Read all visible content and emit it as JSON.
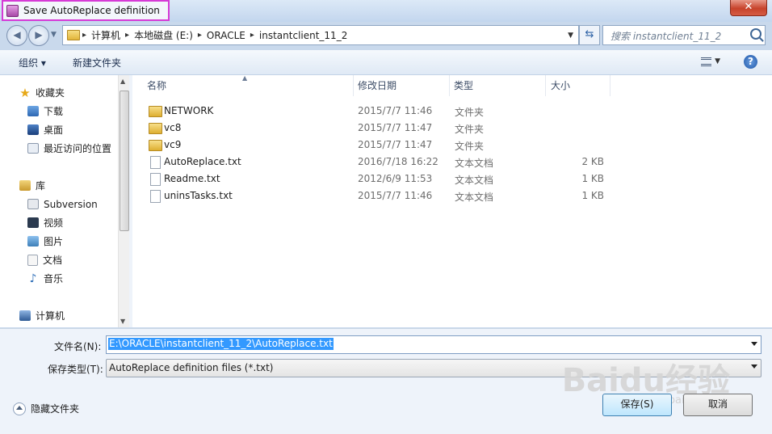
{
  "window": {
    "title": "Save AutoReplace definition",
    "close_label": "✕"
  },
  "address": {
    "crumbs": [
      "计算机",
      "本地磁盘 (E:)",
      "ORACLE",
      "instantclient_11_2"
    ],
    "search_placeholder": "搜索 instantclient_11_2"
  },
  "toolbar": {
    "organize_label": "组织 ▾",
    "new_folder_label": "新建文件夹",
    "help_label": "?"
  },
  "nav": {
    "favorites": {
      "label": "收藏夹",
      "items": [
        "下载",
        "桌面",
        "最近访问的位置"
      ]
    },
    "libraries": {
      "label": "库",
      "items": [
        "Subversion",
        "视频",
        "图片",
        "文档",
        "音乐"
      ]
    },
    "computer": {
      "label": "计算机"
    }
  },
  "columns": {
    "name": "名称",
    "date": "修改日期",
    "type": "类型",
    "size": "大小"
  },
  "files": [
    {
      "name": "NETWORK",
      "date": "2015/7/7 11:46",
      "type": "文件夹",
      "size": "",
      "kind": "folder"
    },
    {
      "name": "vc8",
      "date": "2015/7/7 11:47",
      "type": "文件夹",
      "size": "",
      "kind": "folder"
    },
    {
      "name": "vc9",
      "date": "2015/7/7 11:47",
      "type": "文件夹",
      "size": "",
      "kind": "folder"
    },
    {
      "name": "AutoReplace.txt",
      "date": "2016/7/18 16:22",
      "type": "文本文档",
      "size": "2 KB",
      "kind": "file"
    },
    {
      "name": "Readme.txt",
      "date": "2012/6/9 11:53",
      "type": "文本文档",
      "size": "1 KB",
      "kind": "file"
    },
    {
      "name": "uninsTasks.txt",
      "date": "2015/7/7 11:46",
      "type": "文本文档",
      "size": "1 KB",
      "kind": "file"
    }
  ],
  "form": {
    "filename_label": "文件名(N):",
    "filename_value": "E:\\ORACLE\\instantclient_11_2\\AutoReplace.txt",
    "filetype_label": "保存类型(T):",
    "filetype_value": "AutoReplace definition files (*.txt)"
  },
  "footer": {
    "hide_folders_label": "隐藏文件夹",
    "save_label": "保存(S)",
    "cancel_label": "取消"
  },
  "watermark": {
    "brand": "Baidu经验",
    "url": "jingyan.baidu.com"
  }
}
